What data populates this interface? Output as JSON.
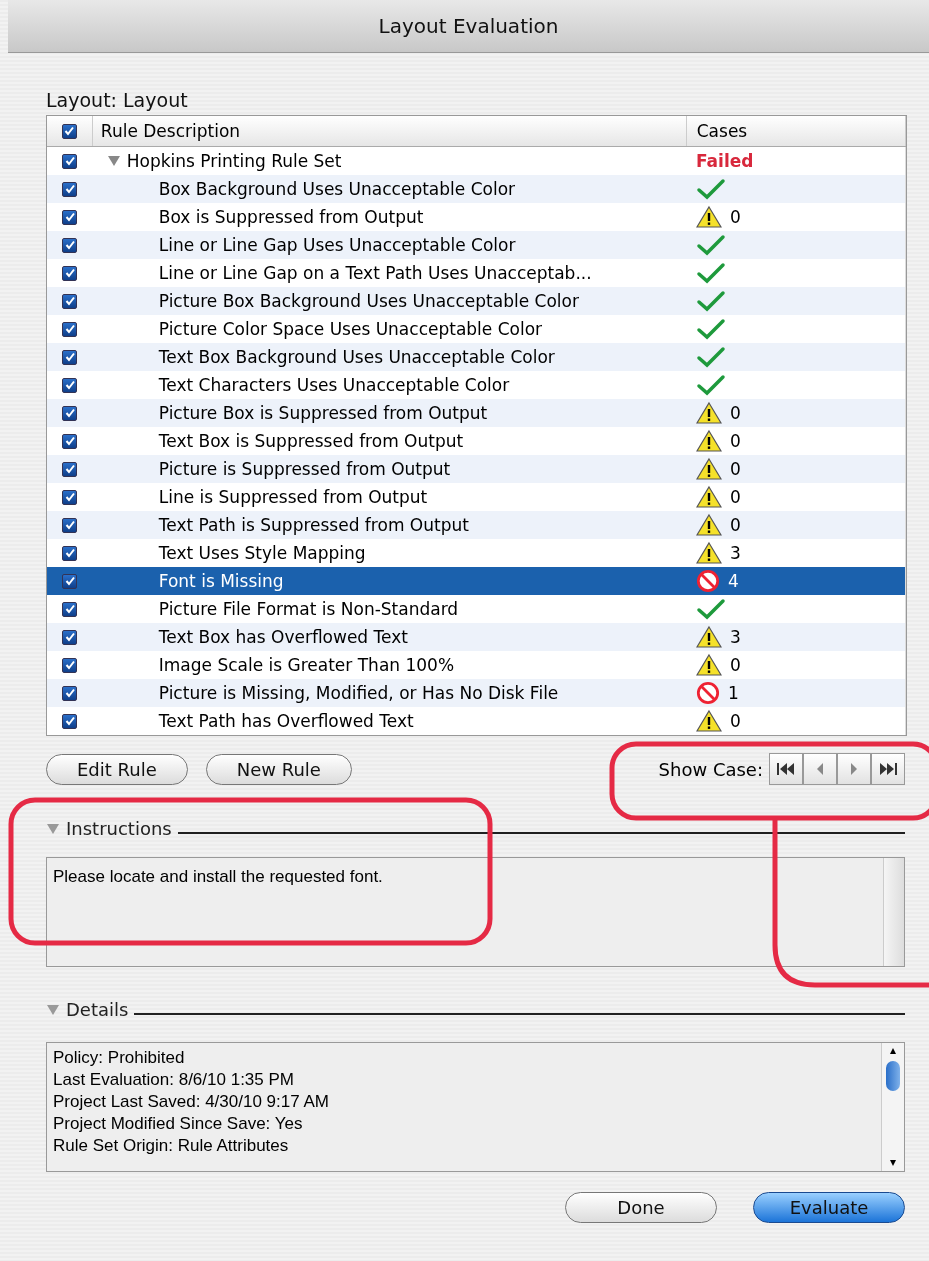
{
  "window": {
    "title": "Layout Evaluation"
  },
  "layout_label": "Layout: Layout",
  "table": {
    "all_checked": true,
    "columns": [
      "Rule Description",
      "Cases"
    ],
    "group": {
      "label": "Hopkins Printing Rule Set",
      "checked": true,
      "expanded": true,
      "result": "Failed",
      "selected": false
    },
    "rows": [
      {
        "label": "Box Background Uses Unacceptable Color",
        "checked": true,
        "kind": "pass",
        "selected": false
      },
      {
        "label": "Box is Suppressed from Output",
        "checked": true,
        "kind": "warning",
        "count": "0",
        "selected": false
      },
      {
        "label": "Line or Line Gap Uses Unacceptable Color",
        "checked": true,
        "kind": "pass",
        "selected": false
      },
      {
        "label": "Line or Line Gap on a Text Path Uses Unacceptab...",
        "checked": true,
        "kind": "pass",
        "selected": false
      },
      {
        "label": "Picture Box Background Uses Unacceptable Color",
        "checked": true,
        "kind": "pass",
        "selected": false
      },
      {
        "label": "Picture Color Space Uses Unacceptable Color",
        "checked": true,
        "kind": "pass",
        "selected": false
      },
      {
        "label": "Text Box Background Uses Unacceptable Color",
        "checked": true,
        "kind": "pass",
        "selected": false
      },
      {
        "label": "Text Characters Uses Unacceptable Color",
        "checked": true,
        "kind": "pass",
        "selected": false
      },
      {
        "label": "Picture Box is Suppressed from Output",
        "checked": true,
        "kind": "warning",
        "count": "0",
        "selected": false
      },
      {
        "label": "Text Box is Suppressed from Output",
        "checked": true,
        "kind": "warning",
        "count": "0",
        "selected": false
      },
      {
        "label": "Picture is Suppressed from Output",
        "checked": true,
        "kind": "warning",
        "count": "0",
        "selected": false
      },
      {
        "label": "Line is Suppressed from Output",
        "checked": true,
        "kind": "warning",
        "count": "0",
        "selected": false
      },
      {
        "label": "Text Path is Suppressed from Output",
        "checked": true,
        "kind": "warning",
        "count": "0",
        "selected": false
      },
      {
        "label": "Text Uses Style Mapping",
        "checked": true,
        "kind": "warning",
        "count": "3",
        "selected": false
      },
      {
        "label": "Font is Missing",
        "checked": true,
        "kind": "error",
        "count": "4",
        "selected": true
      },
      {
        "label": "Picture File Format is Non-Standard",
        "checked": true,
        "kind": "pass",
        "selected": false
      },
      {
        "label": "Text Box has Overflowed Text",
        "checked": true,
        "kind": "warning",
        "count": "3",
        "selected": false
      },
      {
        "label": "Image Scale is Greater Than 100%",
        "checked": true,
        "kind": "warning",
        "count": "0",
        "selected": false
      },
      {
        "label": "Picture is Missing, Modified, or Has No Disk File",
        "checked": true,
        "kind": "error",
        "count": "1",
        "selected": false
      },
      {
        "label": "Text Path has Overflowed Text",
        "checked": true,
        "kind": "warning",
        "count": "0",
        "selected": false
      }
    ]
  },
  "rule_buttons": [
    "Edit Rule",
    "New Rule"
  ],
  "show_case_label": "Show Case:",
  "instructions": {
    "title": "Instructions",
    "expanded": true,
    "text": "Please locate and install the requested font."
  },
  "details": {
    "title": "Details",
    "expanded": true,
    "lines": [
      "Policy: Prohibited",
      "Last Evaluation: 8/6/10  1:35 PM",
      "Project Last Saved: 4/30/10  9:17 AM",
      "Project Modified Since Save: Yes",
      "Rule Set Origin: Rule Attributes"
    ]
  },
  "footer_buttons": [
    {
      "label": "Done",
      "default": false
    },
    {
      "label": "Evaluate",
      "default": true
    }
  ]
}
